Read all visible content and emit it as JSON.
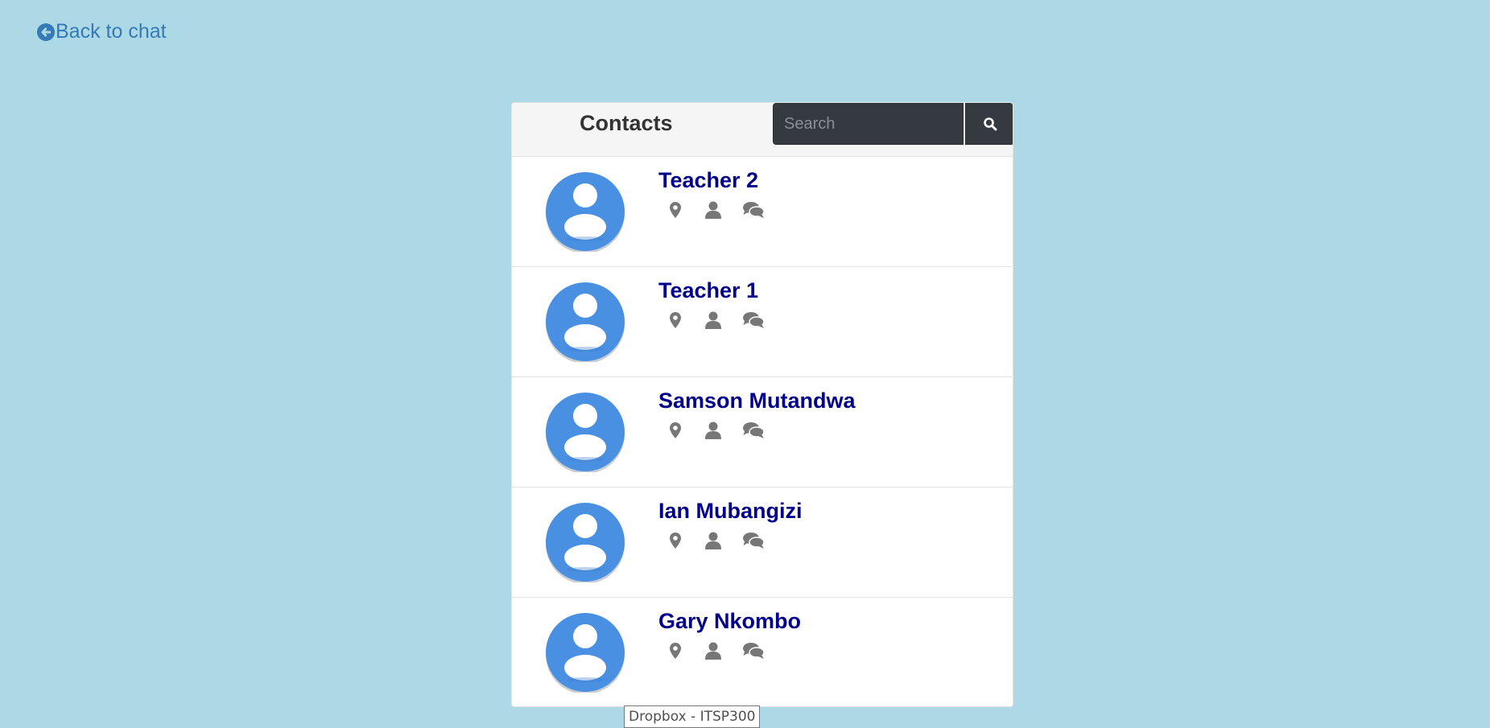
{
  "back_link": {
    "label": "Back to chat",
    "icon": "arrow-circle-left-icon"
  },
  "panel": {
    "title": "Contacts",
    "search": {
      "placeholder": "Search",
      "value": "",
      "button_icon": "search-icon"
    }
  },
  "contacts": [
    {
      "name": "Teacher 2"
    },
    {
      "name": "Teacher 1"
    },
    {
      "name": "Samson Mutandwa"
    },
    {
      "name": "Ian Mubangizi"
    },
    {
      "name": "Gary Nkombo"
    }
  ],
  "contact_action_icons": [
    "map-marker-icon",
    "user-icon",
    "comments-icon"
  ],
  "tooltip": {
    "text": "Dropbox - ITSP300"
  },
  "colors": {
    "background": "#add8e6",
    "link": "#337ab7",
    "contact_name": "#00008b",
    "search_bar": "#343a40",
    "avatar": "#4a90e2",
    "icon_gray": "#777777"
  }
}
